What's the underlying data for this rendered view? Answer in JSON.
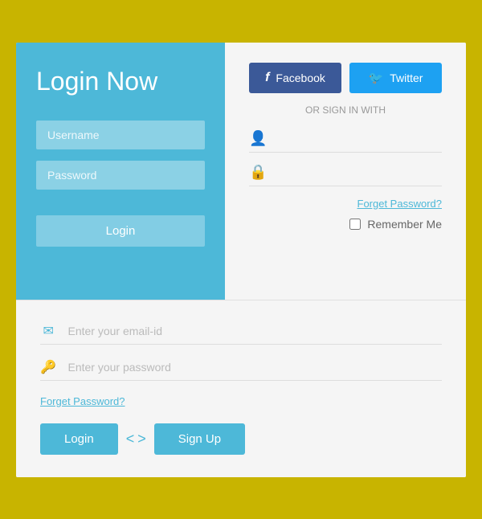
{
  "page": {
    "background_color": "#c8b400"
  },
  "left_panel": {
    "title": "Login Now",
    "username_placeholder": "Username",
    "password_placeholder": "Password",
    "login_button_label": "Login"
  },
  "right_panel": {
    "facebook_button_label": "Facebook",
    "twitter_button_label": "Twitter",
    "or_sign_in_text": "OR SIGN IN WITH",
    "username_placeholder": "",
    "password_placeholder": "",
    "forgot_password_label": "Forget Password?",
    "remember_me_label": "Remember Me"
  },
  "bottom_section": {
    "email_placeholder": "Enter your email-id",
    "password_placeholder": "Enter your password",
    "forgot_password_label": "Forget Password?",
    "login_button_label": "Login",
    "signup_button_label": "Sign Up"
  },
  "icons": {
    "facebook": "f",
    "twitter": "t",
    "user": "👤",
    "lock": "🔒",
    "email": "✉",
    "key": "🔑",
    "chevron_left": "<",
    "chevron_right": ">"
  }
}
